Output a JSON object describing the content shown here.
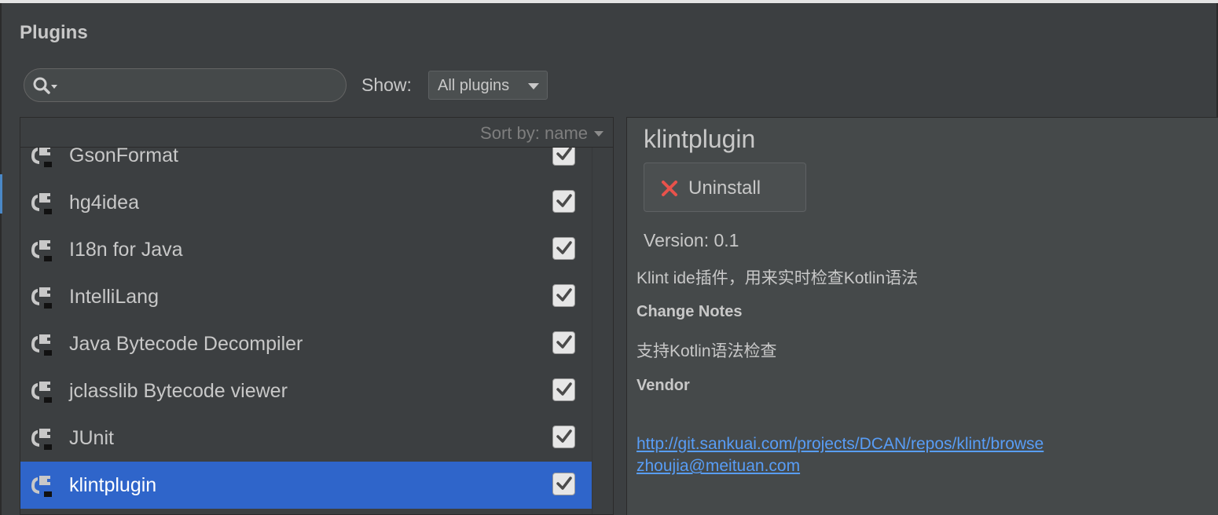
{
  "window": {
    "title": "Plugins"
  },
  "search": {
    "value": "",
    "placeholder": ""
  },
  "filter": {
    "label": "Show:",
    "selected": "All plugins"
  },
  "sort": {
    "label": "Sort by: name"
  },
  "plugins": [
    {
      "name": "GsonFormat",
      "enabled": true
    },
    {
      "name": "hg4idea",
      "enabled": true
    },
    {
      "name": "I18n for Java",
      "enabled": true
    },
    {
      "name": "IntelliLang",
      "enabled": true
    },
    {
      "name": "Java Bytecode Decompiler",
      "enabled": true
    },
    {
      "name": "jclasslib Bytecode viewer",
      "enabled": true
    },
    {
      "name": "JUnit",
      "enabled": true
    },
    {
      "name": "klintplugin",
      "enabled": true
    }
  ],
  "selected_index": 7,
  "details": {
    "name": "klintplugin",
    "uninstall_label": "Uninstall",
    "version": "Version: 0.1",
    "description": "Klint ide插件，用来实时检查Kotlin语法",
    "change_notes_heading": "Change Notes",
    "change_notes": "支持Kotlin语法检查",
    "vendor_heading": "Vendor",
    "vendor_url": "http://git.sankuai.com/projects/DCAN/repos/klint/browse",
    "vendor_email": "zhoujia@meituan.com"
  },
  "colors": {
    "background": "#3c3f41",
    "selection": "#2f65ca",
    "link": "#589df6",
    "uninstall_icon": "#e8524b"
  },
  "icons": {
    "search": "search-icon",
    "plugin": "plugin-icon",
    "uninstall": "close-icon",
    "checkbox": "checkmark-icon"
  }
}
